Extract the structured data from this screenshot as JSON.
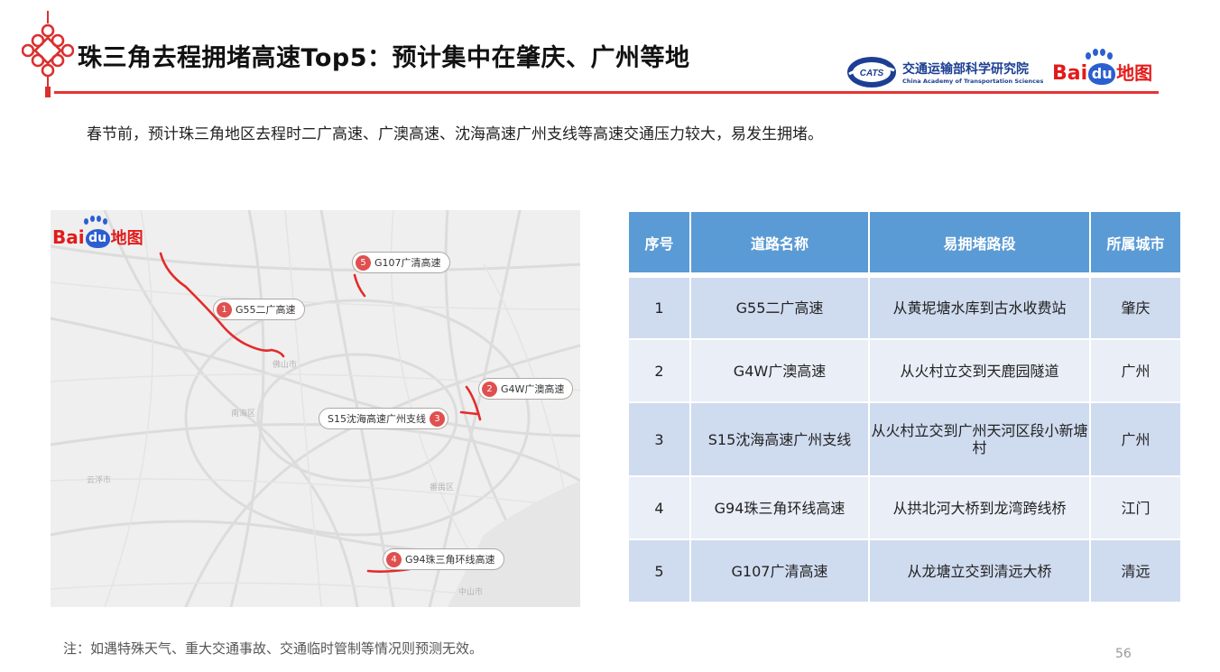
{
  "header": {
    "title": "珠三角去程拥堵高速Top5：预计集中在肇庆、广州等地",
    "org_cn": "交通运输部科学研究院",
    "org_en": "China Academy of Transportation Sciences",
    "baidu": {
      "bai": "Bai",
      "du": "du",
      "cn": "地图"
    }
  },
  "subtitle": "春节前，预计珠三角地区去程时二广高速、广澳高速、沈海高速广州支线等高速交通压力较大，易发生拥堵。",
  "map": {
    "baidu": {
      "bai": "Bai",
      "du": "du",
      "cn": "地图"
    },
    "markers": [
      {
        "num": "1",
        "label": "G55二广高速"
      },
      {
        "num": "2",
        "label": "G4W广澳高速"
      },
      {
        "num": "3",
        "label": "S15沈海高速广州支线"
      },
      {
        "num": "4",
        "label": "G94珠三角环线高速"
      },
      {
        "num": "5",
        "label": "G107广清高速"
      }
    ],
    "cities": [
      "佛山市",
      "南海区",
      "番禺区",
      "中山市",
      "云浮市"
    ],
    "colors": {
      "congestion": "#e32b2b",
      "marker": "#e05050"
    }
  },
  "table": {
    "headers": [
      "序号",
      "道路名称",
      "易拥堵路段",
      "所属城市"
    ],
    "rows": [
      [
        "1",
        "G55二广高速",
        "从黄坭塘水库到古水收费站",
        "肇庆"
      ],
      [
        "2",
        "G4W广澳高速",
        "从火村立交到天鹿园隧道",
        "广州"
      ],
      [
        "3",
        "S15沈海高速广州支线",
        "从火村立交到广州天河区段小新塘村",
        "广州"
      ],
      [
        "4",
        "G94珠三角环线高速",
        "从拱北河大桥到龙湾跨线桥",
        "江门"
      ],
      [
        "5",
        "G107广清高速",
        "从龙塘立交到清远大桥",
        "清远"
      ]
    ],
    "colors": {
      "header": "#5b9bd5",
      "row_odd": "#cfdbef",
      "row_even": "#e9eef7"
    }
  },
  "note": "注：如遇特殊天气、重大交通事故、交通临时管制等情况则预测无效。",
  "page_number": "56"
}
